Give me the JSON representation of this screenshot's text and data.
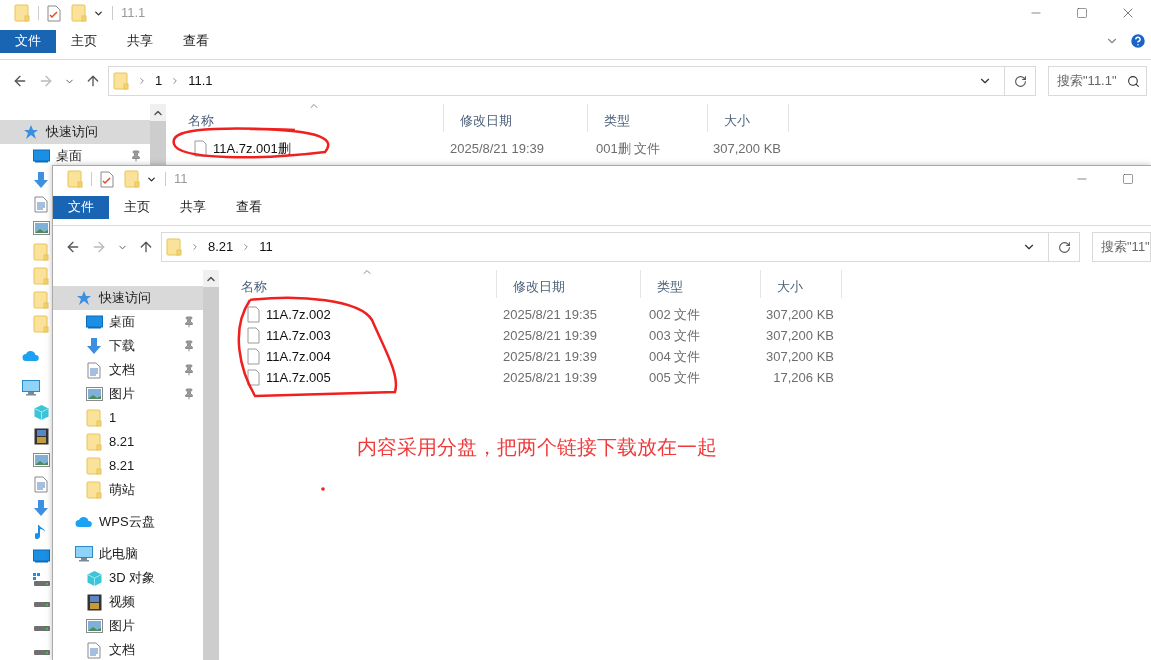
{
  "back_window": {
    "title": "11.1",
    "ribbon_tabs": [
      {
        "label": "文件",
        "selected": true
      },
      {
        "label": "主页",
        "selected": false
      },
      {
        "label": "共享",
        "selected": false
      },
      {
        "label": "查看",
        "selected": false
      }
    ],
    "address": {
      "path": [
        "1",
        "11.1"
      ]
    },
    "search": {
      "placeholder": "搜索\"11.1\""
    },
    "sidebar": [
      {
        "kind": "star",
        "label": "快速访问",
        "selected": true,
        "children": [
          {
            "kind": "desktop",
            "label": "桌面",
            "pinned": true
          },
          {
            "kind": "download"
          },
          {
            "kind": "document"
          },
          {
            "kind": "picture"
          },
          {
            "kind": "folder"
          },
          {
            "kind": "folder"
          },
          {
            "kind": "folder"
          },
          {
            "kind": "folder"
          }
        ]
      },
      {
        "kind": "cloud",
        "selected": false
      },
      {
        "kind": "pc",
        "selected": false,
        "children": [
          {
            "kind": "cube"
          },
          {
            "kind": "video"
          },
          {
            "kind": "picture"
          },
          {
            "kind": "document"
          },
          {
            "kind": "download"
          },
          {
            "kind": "music"
          },
          {
            "kind": "desktop"
          },
          {
            "kind": "system-drive"
          },
          {
            "kind": "drive"
          },
          {
            "kind": "drive"
          },
          {
            "kind": "drive"
          }
        ]
      }
    ],
    "columns": [
      "名称",
      "修改日期",
      "类型",
      "大小"
    ],
    "rows": [
      {
        "name": "11A.7z.001删",
        "date": "2025/8/21 19:39",
        "type": "001删 文件",
        "size": "307,200 KB"
      }
    ]
  },
  "front_window": {
    "title": "11",
    "ribbon_tabs": [
      {
        "label": "文件",
        "selected": true
      },
      {
        "label": "主页",
        "selected": false
      },
      {
        "label": "共享",
        "selected": false
      },
      {
        "label": "查看",
        "selected": false
      }
    ],
    "address": {
      "path": [
        "8.21",
        "11"
      ]
    },
    "search": {
      "placeholder": "搜索\"11\""
    },
    "sidebar": [
      {
        "kind": "star",
        "label": "快速访问",
        "selected": true,
        "children": [
          {
            "kind": "desktop",
            "label": "桌面",
            "pinned": true
          },
          {
            "kind": "download",
            "label": "下载",
            "pinned": true
          },
          {
            "kind": "document",
            "label": "文档",
            "pinned": true
          },
          {
            "kind": "picture",
            "label": "图片",
            "pinned": true
          },
          {
            "kind": "folder",
            "label": "1",
            "pinned": false
          },
          {
            "kind": "folder",
            "label": "8.21",
            "pinned": false
          },
          {
            "kind": "folder",
            "label": "8.21",
            "pinned": false
          },
          {
            "kind": "folder",
            "label": "萌站",
            "pinned": false
          }
        ]
      },
      {
        "kind": "cloud",
        "label": "WPS云盘",
        "selected": false
      },
      {
        "kind": "pc",
        "label": "此电脑",
        "selected": false,
        "children": [
          {
            "kind": "cube",
            "label": "3D 对象"
          },
          {
            "kind": "video",
            "label": "视频"
          },
          {
            "kind": "picture",
            "label": "图片"
          },
          {
            "kind": "document",
            "label": "文档"
          }
        ]
      }
    ],
    "columns": [
      "名称",
      "修改日期",
      "类型",
      "大小"
    ],
    "rows": [
      {
        "name": "11A.7z.002",
        "date": "2025/8/21 19:35",
        "type": "002 文件",
        "size": "307,200 KB"
      },
      {
        "name": "11A.7z.003",
        "date": "2025/8/21 19:39",
        "type": "003 文件",
        "size": "307,200 KB"
      },
      {
        "name": "11A.7z.004",
        "date": "2025/8/21 19:39",
        "type": "004 文件",
        "size": "307,200 KB"
      },
      {
        "name": "11A.7z.005",
        "date": "2025/8/21 19:39",
        "type": "005 文件",
        "size": "17,206 KB"
      }
    ]
  },
  "annotation": {
    "text": "内容采用分盘，把两个链接下载放在一起"
  }
}
